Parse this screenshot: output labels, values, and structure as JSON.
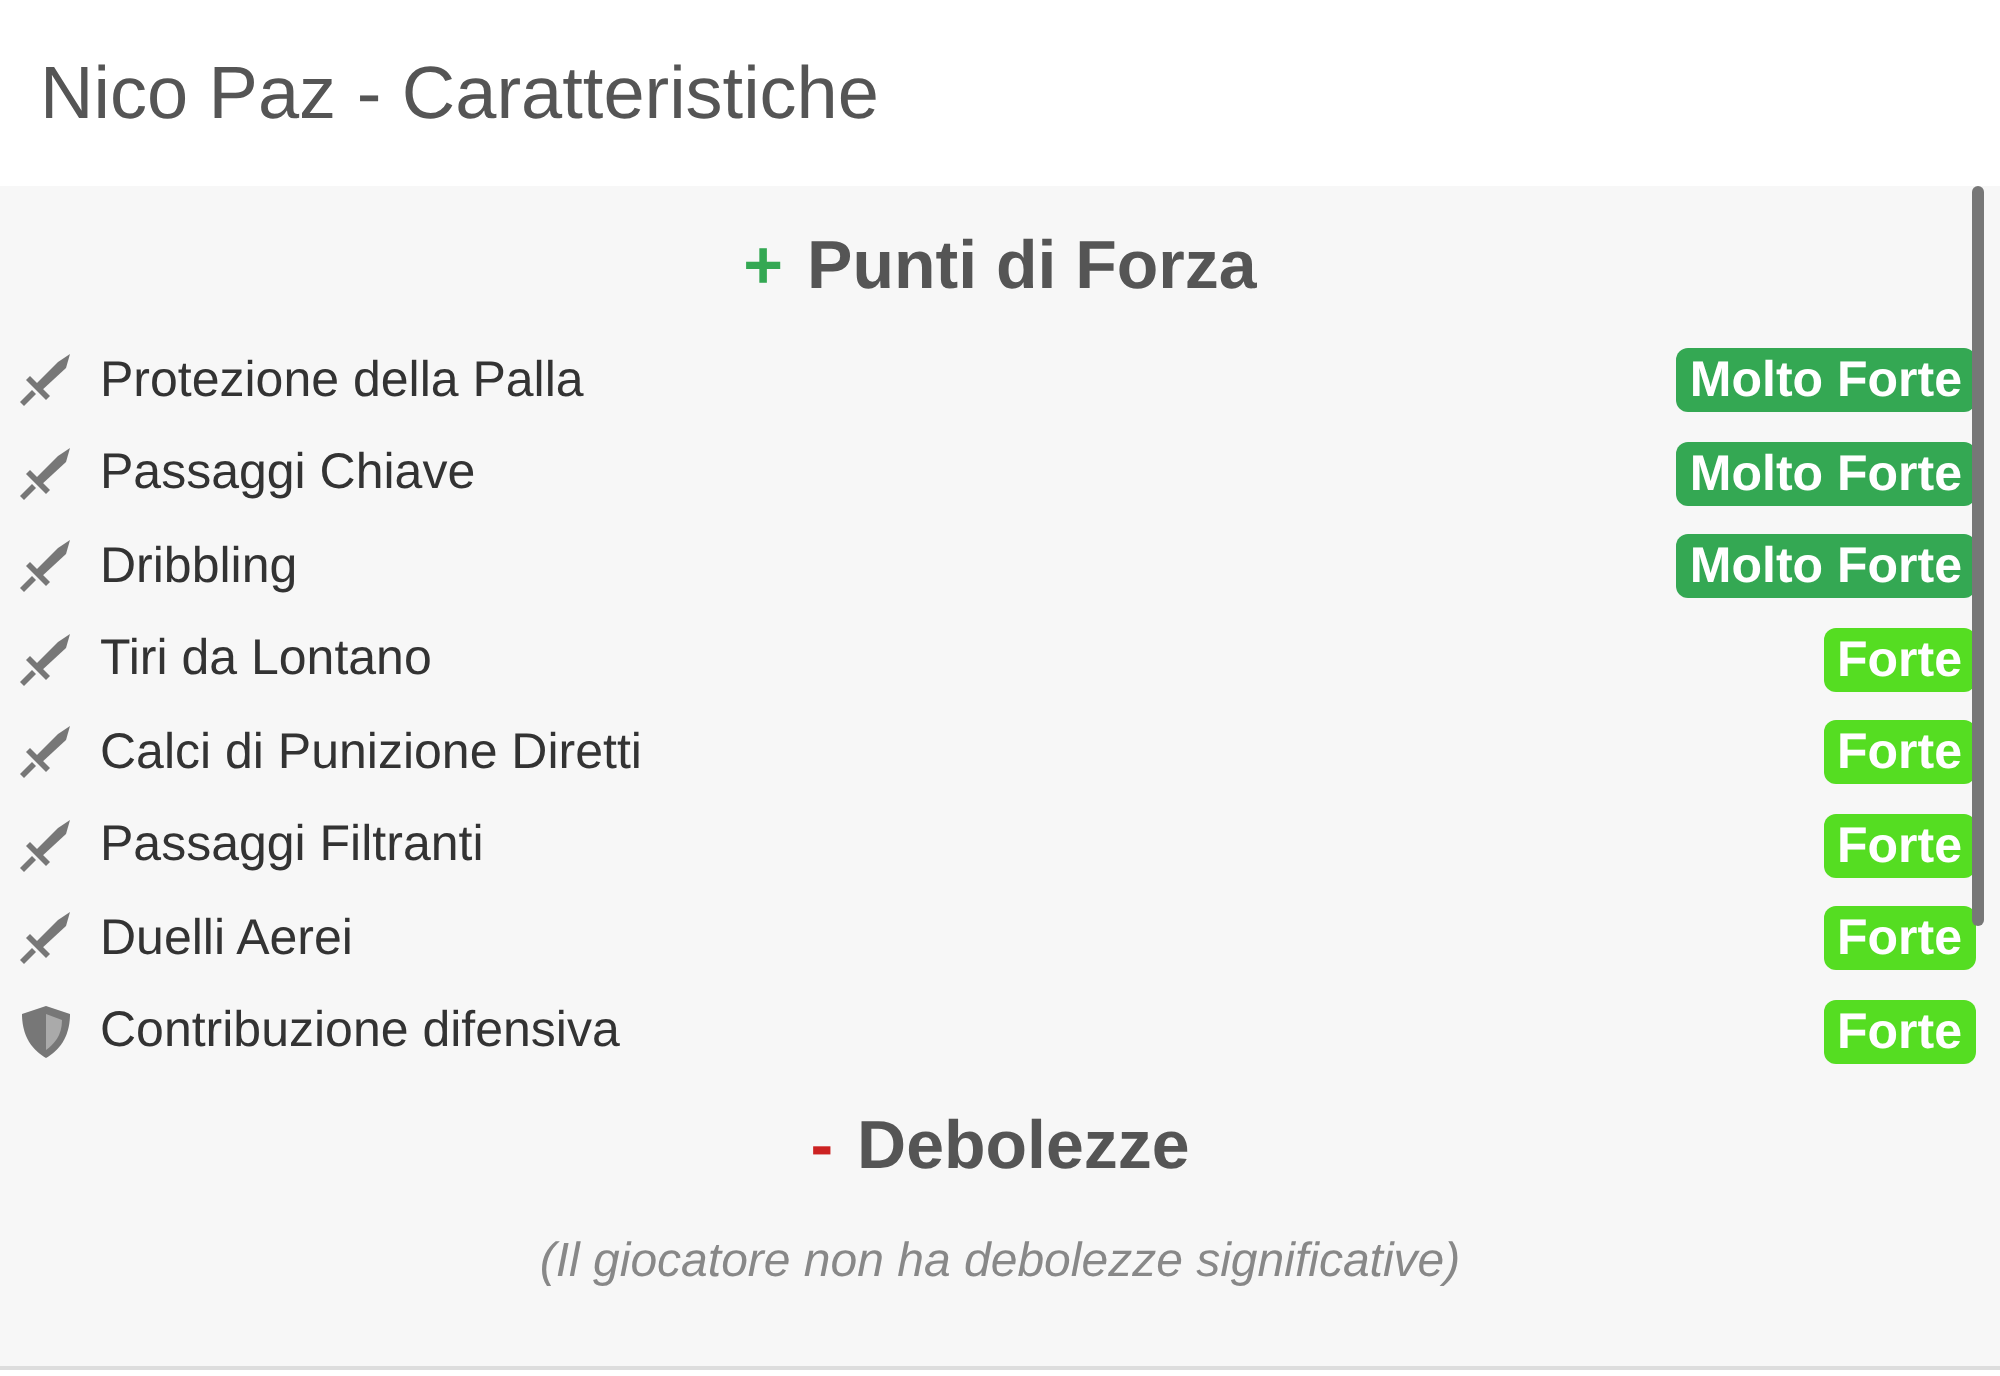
{
  "title": "Nico Paz - Caratteristiche",
  "sections": [
    {
      "kind": "strengths",
      "sign": "+",
      "heading": "Punti di Forza",
      "items": [
        {
          "kind": "sword",
          "label": "Protezione della Palla",
          "rating": "Molto Forte",
          "color": "#34a853"
        },
        {
          "kind": "sword",
          "label": "Passaggi Chiave",
          "rating": "Molto Forte",
          "color": "#34a853"
        },
        {
          "kind": "sword",
          "label": "Dribbling",
          "rating": "Molto Forte",
          "color": "#34a853"
        },
        {
          "kind": "sword",
          "label": "Tiri da Lontano",
          "rating": "Forte",
          "color": "#55dd22"
        },
        {
          "kind": "sword",
          "label": "Calci di Punizione Diretti",
          "rating": "Forte",
          "color": "#55dd22"
        },
        {
          "kind": "sword",
          "label": "Passaggi Filtranti",
          "rating": "Forte",
          "color": "#55dd22"
        },
        {
          "kind": "sword",
          "label": "Duelli Aerei",
          "rating": "Forte",
          "color": "#55dd22"
        },
        {
          "kind": "shield",
          "label": "Contribuzione difensiva",
          "rating": "Forte",
          "color": "#55dd22"
        }
      ]
    },
    {
      "kind": "weaknesses",
      "sign": "-",
      "heading": "Debolezze",
      "note": "(Il giocatore non ha debolezze significative)"
    }
  ]
}
